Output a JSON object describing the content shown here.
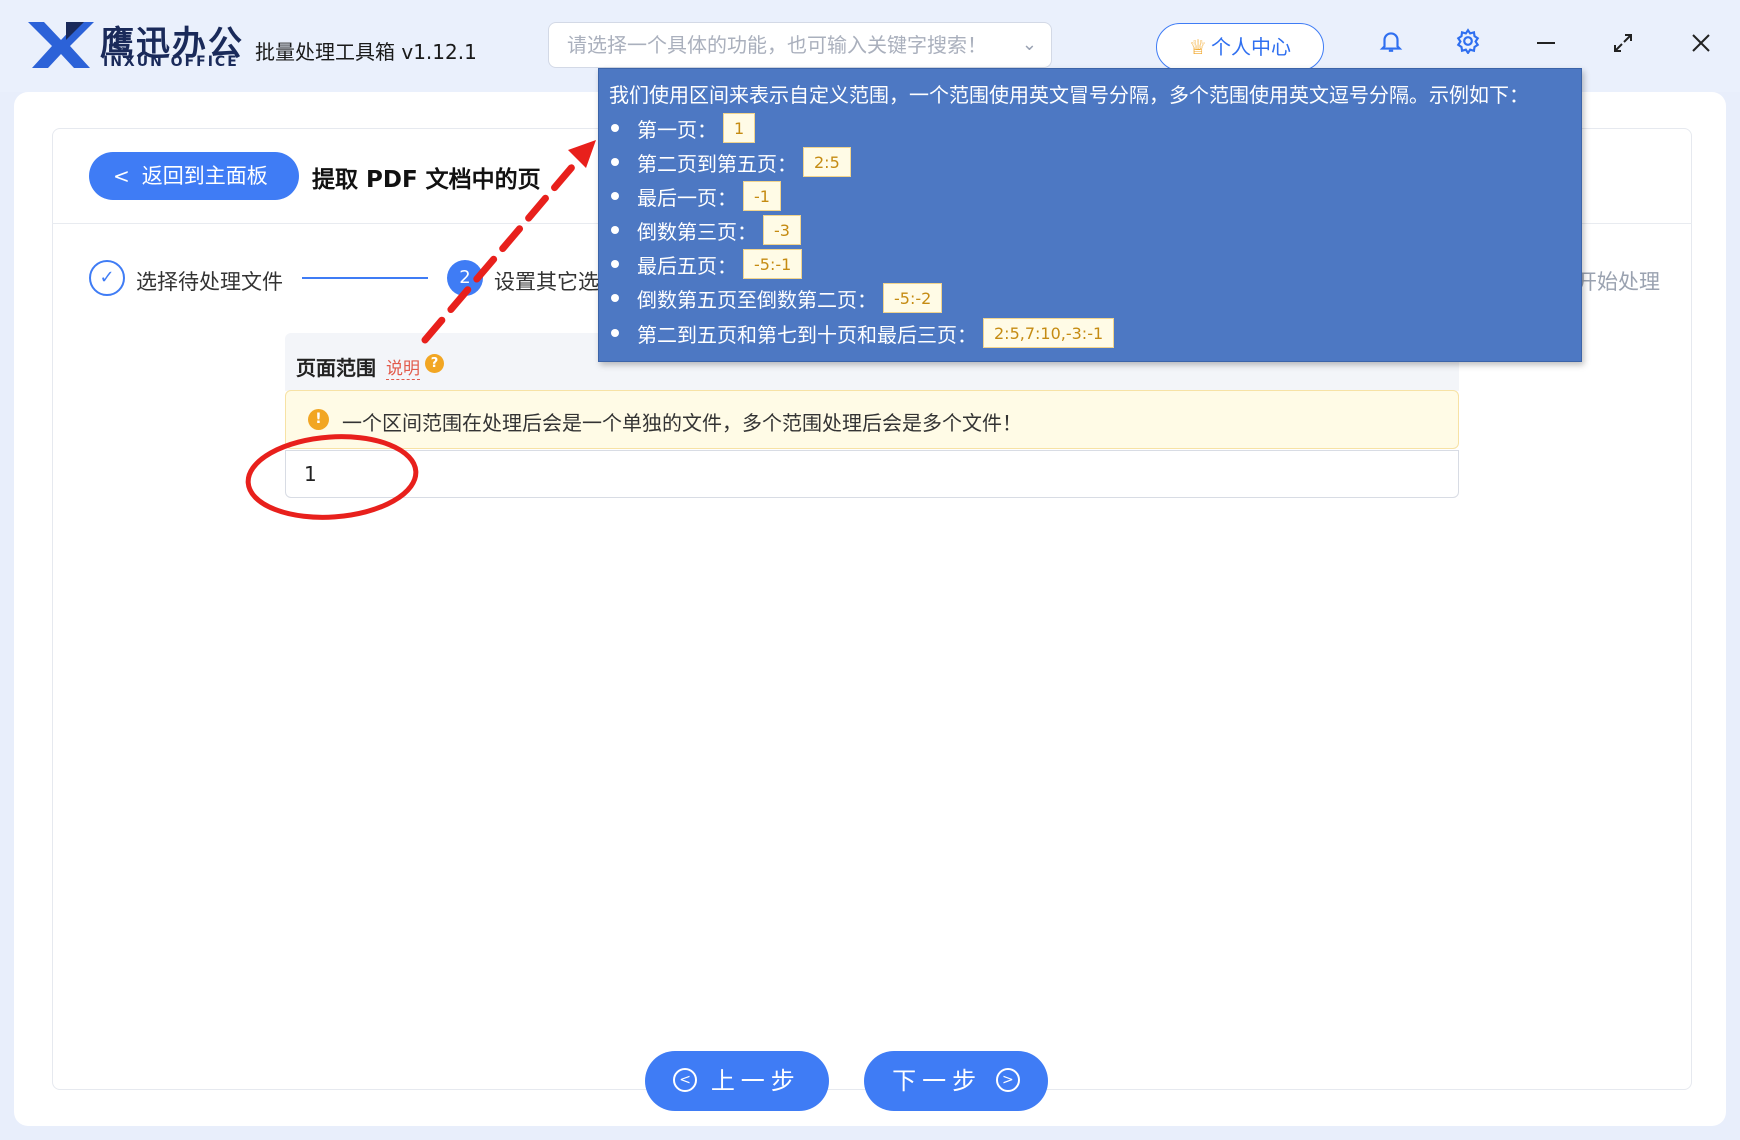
{
  "app": {
    "brand_cn": "鹰迅办公",
    "brand_en": "INXUN OFFICE",
    "title": "批量处理工具箱 v1.12.1"
  },
  "search": {
    "placeholder": "请选择一个具体的功能，也可输入关键字搜索！"
  },
  "header": {
    "user_center": "个人中心",
    "icons": [
      "bell-icon",
      "gear-icon",
      "minimize-icon",
      "maximize-icon",
      "close-icon"
    ]
  },
  "page": {
    "back_label": "返回到主面板",
    "title": "提取 PDF 文档中的页"
  },
  "steps": [
    {
      "label": "选择待处理文件",
      "state": "done"
    },
    {
      "label": "设置其它选",
      "number": "2",
      "state": "active"
    },
    {
      "label": "开始处理",
      "state": "pending"
    }
  ],
  "form": {
    "range_label": "页面范围",
    "explain_link": "说明",
    "help_glyph": "?",
    "warning": "一个区间范围在处理后会是一个单独的文件，多个范围处理后会是多个文件！",
    "warning_glyph": "!",
    "range_value": "1"
  },
  "tooltip": {
    "title": "我们使用区间来表示自定义范围，一个范围使用英文冒号分隔，多个范围使用英文逗号分隔。示例如下：",
    "items": [
      {
        "label": "第一页：",
        "code": "1"
      },
      {
        "label": "第二页到第五页：",
        "code": "2:5"
      },
      {
        "label": "最后一页：",
        "code": "-1"
      },
      {
        "label": "倒数第三页：",
        "code": "-3"
      },
      {
        "label": "最后五页：",
        "code": "-5:-1"
      },
      {
        "label": "倒数第五页至倒数第二页：",
        "code": "-5:-2"
      },
      {
        "label": "第二到五页和第七到十页和最后三页：",
        "code": "2:5,7:10,-3:-1"
      }
    ]
  },
  "nav": {
    "prev": "上一步",
    "next": "下一步"
  },
  "colors": {
    "primary": "#3f7cf5",
    "tooltip_bg": "#4d78c3",
    "warning": "#f2a623",
    "annotation": "#e8201c"
  }
}
